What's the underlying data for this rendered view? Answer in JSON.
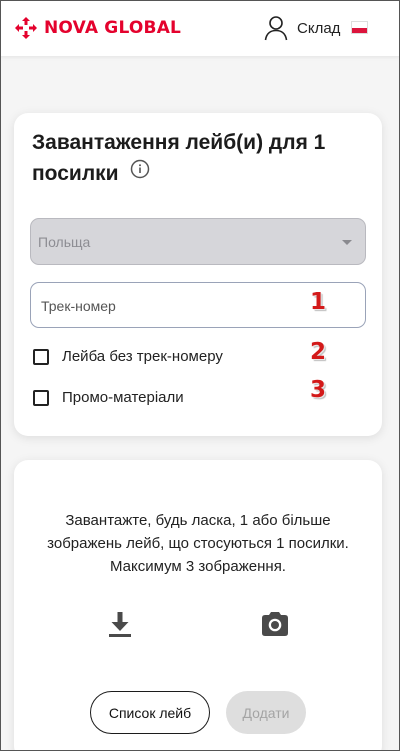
{
  "header": {
    "brand": "NOVA GLOBAL",
    "user_label": "Склад",
    "brand_color": "#e4022d",
    "flag": "poland-flag"
  },
  "upload_card": {
    "title": "Завантаження лейб(и) для 1 посилки",
    "info_icon": "info-icon",
    "country_select": {
      "selected_value": "Польща",
      "disabled": true
    },
    "tracking_input": {
      "placeholder": "Трек-номер",
      "value": ""
    },
    "checkboxes": [
      {
        "label": "Лейба без трек-номеру",
        "checked": false
      },
      {
        "label": "Промо-матеріали",
        "checked": false
      }
    ],
    "markers": [
      "1",
      "2",
      "3"
    ]
  },
  "files_card": {
    "instructions": "Завантажте, будь ласка, 1 або більше зображень лейб, що стосуються 1 посилки. Максимум 3 зображення.",
    "icons": [
      "download-icon",
      "camera-icon"
    ],
    "list_button": "Список лейб",
    "add_button": "Додати",
    "add_button_disabled": true
  }
}
